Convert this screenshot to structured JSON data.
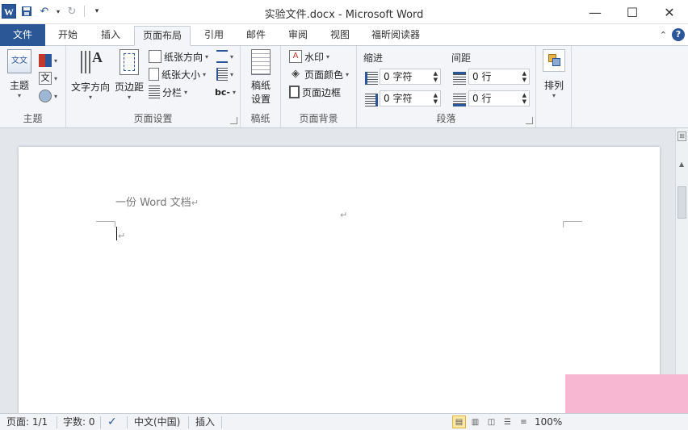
{
  "window": {
    "title": "实验文件.docx - Microsoft Word",
    "app_logo": "W",
    "controls": [
      "minimize-icon",
      "maximize-icon",
      "close-icon"
    ]
  },
  "tabs": [
    "文件",
    "开始",
    "插入",
    "页面布局",
    "引用",
    "邮件",
    "审阅",
    "视图",
    "福昕阅读器"
  ],
  "active_tab": "页面布局",
  "ribbon": {
    "theme": {
      "label": "主题",
      "theme_btn": "主题",
      "theme_glyph": "文文",
      "fonts_glyph": "文"
    },
    "page_setup": {
      "label": "页面设置",
      "text_direction": "文字方向",
      "text_direction_glyph": "A",
      "margins": "页边距",
      "orientation": "纸张方向",
      "size": "纸张大小",
      "columns": "分栏",
      "hyphenation_glyph": "bc-"
    },
    "manuscript": {
      "label": "稿纸",
      "btn_line1": "稿纸",
      "btn_line2": "设置"
    },
    "page_background": {
      "label": "页面背景",
      "watermark": "水印",
      "page_color": "页面颜色",
      "page_borders": "页面边框"
    },
    "paragraph": {
      "label": "段落",
      "indent_title": "缩进",
      "spacing_title": "间距",
      "indent_left": "0 字符",
      "indent_right": "0 字符",
      "spacing_before": "0 行",
      "spacing_after": "0 行"
    },
    "arrange": {
      "label": "排列"
    }
  },
  "document": {
    "line1": "一份 Word 文档",
    "para_mark": "↵"
  },
  "statusbar": {
    "page": "页面: 1/1",
    "words": "字数: 0",
    "language": "中文(中国)",
    "insert_mode": "插入",
    "zoom": "100%"
  },
  "colors": {
    "file_tab": "#2b5797",
    "accent": "#2b579a",
    "ribbon_bg": "#f3f5f8",
    "overlay": "#f7b6d2"
  }
}
